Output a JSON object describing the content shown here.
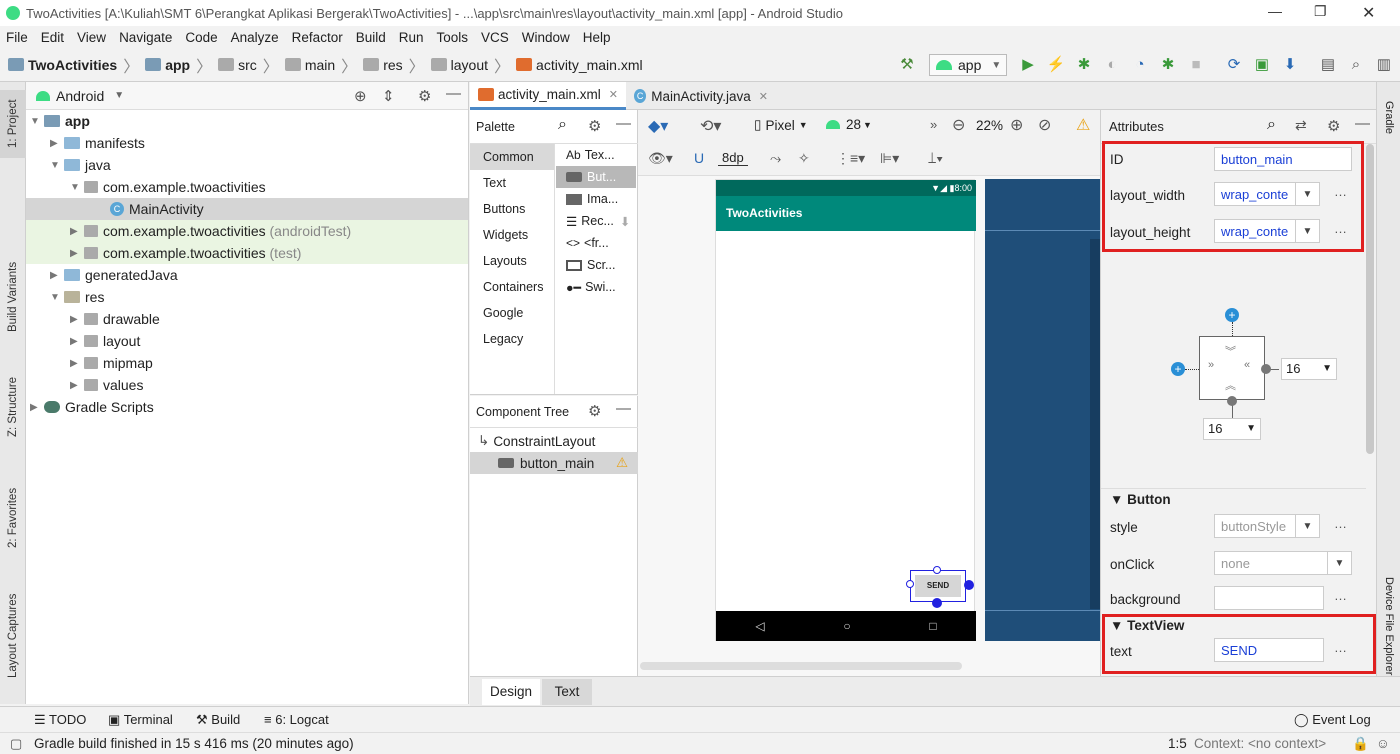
{
  "window": {
    "title": "TwoActivities [A:\\Kuliah\\SMT 6\\Perangkat Aplikasi Bergerak\\TwoActivities] - ...\\app\\src\\main\\res\\layout\\activity_main.xml [app] - Android Studio"
  },
  "menu": [
    "File",
    "Edit",
    "View",
    "Navigate",
    "Code",
    "Analyze",
    "Refactor",
    "Build",
    "Run",
    "Tools",
    "VCS",
    "Window",
    "Help"
  ],
  "breadcrumb": [
    "TwoActivities",
    "app",
    "src",
    "main",
    "res",
    "layout",
    "activity_main.xml"
  ],
  "toolbar": {
    "run_config": "app"
  },
  "left_strip": {
    "project": "1: Project",
    "build_variants": "Build Variants",
    "structure": "Z: Structure",
    "favorites": "2: Favorites",
    "captures": "Layout Captures"
  },
  "right_strip": {
    "gradle": "Gradle",
    "device_explorer": "Device File Explorer"
  },
  "project": {
    "view_mode": "Android",
    "tree": [
      {
        "label": "app",
        "suffix": ""
      },
      {
        "label": "manifests",
        "suffix": ""
      },
      {
        "label": "java",
        "suffix": ""
      },
      {
        "label": "com.example.twoactivities",
        "suffix": ""
      },
      {
        "label": "MainActivity",
        "suffix": ""
      },
      {
        "label": "com.example.twoactivities",
        "suffix": "(androidTest)"
      },
      {
        "label": "com.example.twoactivities",
        "suffix": "(test)"
      },
      {
        "label": "generatedJava",
        "suffix": ""
      },
      {
        "label": "res",
        "suffix": ""
      },
      {
        "label": "drawable",
        "suffix": ""
      },
      {
        "label": "layout",
        "suffix": ""
      },
      {
        "label": "mipmap",
        "suffix": ""
      },
      {
        "label": "values",
        "suffix": ""
      },
      {
        "label": "Gradle Scripts",
        "suffix": ""
      }
    ]
  },
  "editor_tabs": [
    {
      "label": "activity_main.xml"
    },
    {
      "label": "MainActivity.java"
    }
  ],
  "palette": {
    "title": "Palette",
    "categories": [
      "Common",
      "Text",
      "Buttons",
      "Widgets",
      "Layouts",
      "Containers",
      "Google",
      "Legacy"
    ],
    "items": [
      "Tex...",
      "But...",
      "Ima...",
      "Rec...",
      "<fr...",
      "Scr...",
      "Swi..."
    ]
  },
  "component_tree": {
    "title": "Component Tree",
    "root": "ConstraintLayout",
    "child": "button_main"
  },
  "design_toolbar": {
    "device": "Pixel",
    "api": "28",
    "zoom": "22%",
    "margin": "8dp"
  },
  "phone": {
    "time": "8:00",
    "app_title": "TwoActivities",
    "button_text": "SEND"
  },
  "attributes": {
    "title": "Attributes",
    "id_label": "ID",
    "id_value": "button_main",
    "width_label": "layout_width",
    "width_value": "wrap_conte",
    "height_label": "layout_height",
    "height_value": "wrap_conte",
    "margin_right": "16",
    "margin_bottom": "16",
    "button_section": "Button",
    "style_label": "style",
    "style_value": "buttonStyle",
    "onclick_label": "onClick",
    "onclick_value": "none",
    "background_label": "background",
    "textview_section": "TextView",
    "text_label": "text",
    "text_value": "SEND"
  },
  "bottom_tabs": [
    "Design",
    "Text"
  ],
  "tool_windows": {
    "todo": "TODO",
    "terminal": "Terminal",
    "build": "Build",
    "logcat": "6: Logcat",
    "event_log": "Event Log"
  },
  "status": {
    "message": "Gradle build finished in 15 s 416 ms (20 minutes ago)",
    "position": "1:5",
    "context": "Context: <no context>"
  },
  "colors": {
    "accent_red": "#e02020",
    "android_green": "#3ddc84",
    "app_bar": "#00897b",
    "blueprint": "#1f4e79",
    "selection_blue": "#2121e0"
  }
}
